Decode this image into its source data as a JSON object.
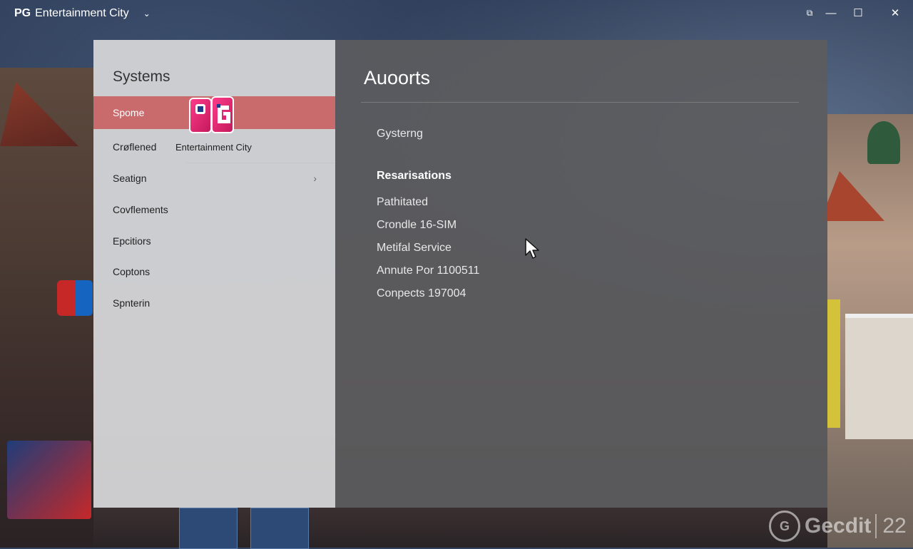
{
  "window": {
    "title_prefix": "PG",
    "title_text": "Entertainment City",
    "chevron": "⌄"
  },
  "window_controls": [
    {
      "name": "compact-overlay-button",
      "glyph": "⧉"
    },
    {
      "name": "minimize-button",
      "glyph": "—"
    },
    {
      "name": "maximize-button",
      "glyph": "☐"
    },
    {
      "name": "close-button",
      "glyph": "✕"
    }
  ],
  "sidebar": {
    "heading": "Systems",
    "logo_caption": "Entertainment City",
    "items": [
      {
        "label": "Spome",
        "active": true
      },
      {
        "label": "Crøflened"
      },
      {
        "label": "Seatign",
        "has_arrow": true
      },
      {
        "label": "Covflements"
      },
      {
        "label": "Epcitiors"
      },
      {
        "label": "Coptons"
      },
      {
        "label": "Spnterin"
      }
    ],
    "arrow_glyph": "›"
  },
  "content": {
    "heading": "Auoorts",
    "subheading": "Gysterng",
    "section_title": "Resarisations",
    "lines": [
      "Pathitated",
      "Crondle 16-SIM",
      "Metifal Service",
      "Annute Por 1100511",
      "Conpects 197004"
    ]
  },
  "watermark": {
    "mark": "G",
    "brand": "Gecdit",
    "number": "22"
  },
  "colors": {
    "active_item": "#c96a6d",
    "left_pane": "#d6d6d8",
    "right_pane": "#5c5c5e"
  }
}
